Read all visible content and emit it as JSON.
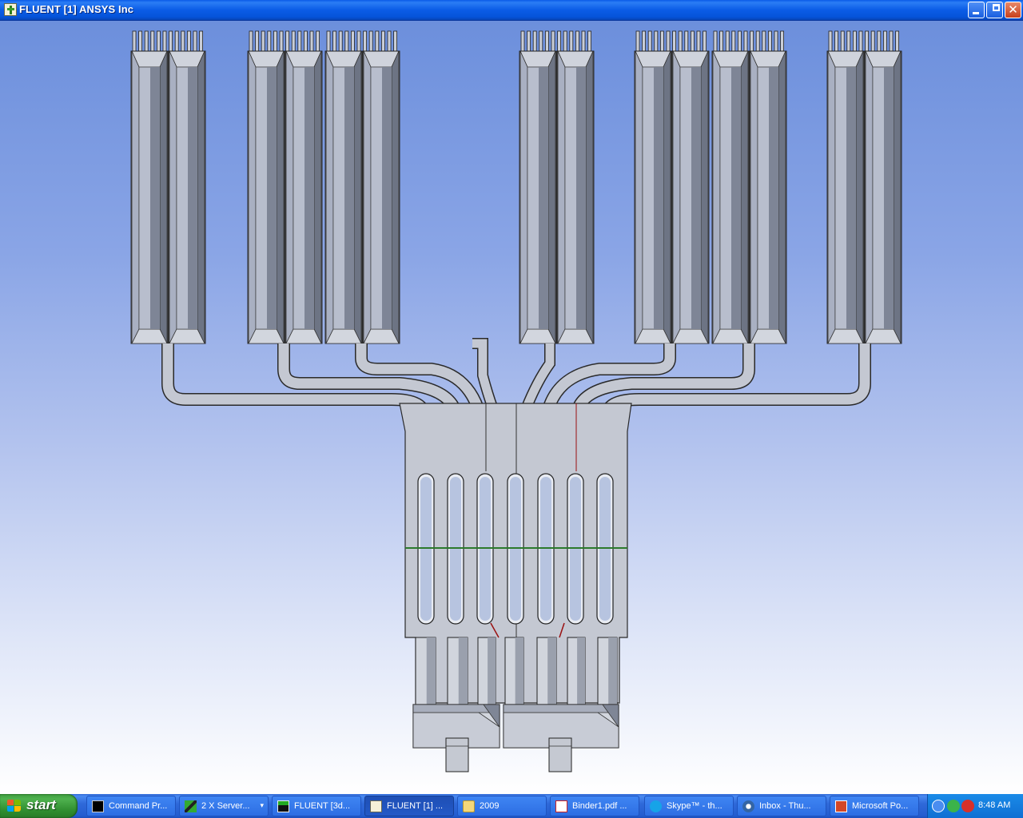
{
  "window": {
    "title": "FLUENT [1] ANSYS Inc"
  },
  "taskbar": {
    "start_label": "start",
    "items": [
      {
        "label": "Command Pr...",
        "icon": "console-icon"
      },
      {
        "label": "2 X Server...",
        "icon": "x-server-icon"
      },
      {
        "label": "FLUENT  [3d...",
        "icon": "fluent-window-icon"
      },
      {
        "label": "FLUENT [1] ...",
        "icon": "fluent-app-icon",
        "active": true
      },
      {
        "label": "2009",
        "icon": "folder-icon"
      },
      {
        "label": "Binder1.pdf ...",
        "icon": "pdf-icon"
      },
      {
        "label": "Skype™ - th...",
        "icon": "skype-icon"
      },
      {
        "label": "Inbox - Thu...",
        "icon": "thunderbird-icon"
      },
      {
        "label": "Microsoft Po...",
        "icon": "powerpoint-icon"
      }
    ],
    "clock": "8:48 AM"
  },
  "colors": {
    "titlebar": "#0b5ce6",
    "viewport_top": "#6c8fdc",
    "viewport_bottom": "#ffffff",
    "mesh_face": "#c4c8d2",
    "mesh_dark": "#6d7484",
    "zone_green": "#2c7a2c",
    "zone_red": "#9a1010"
  }
}
